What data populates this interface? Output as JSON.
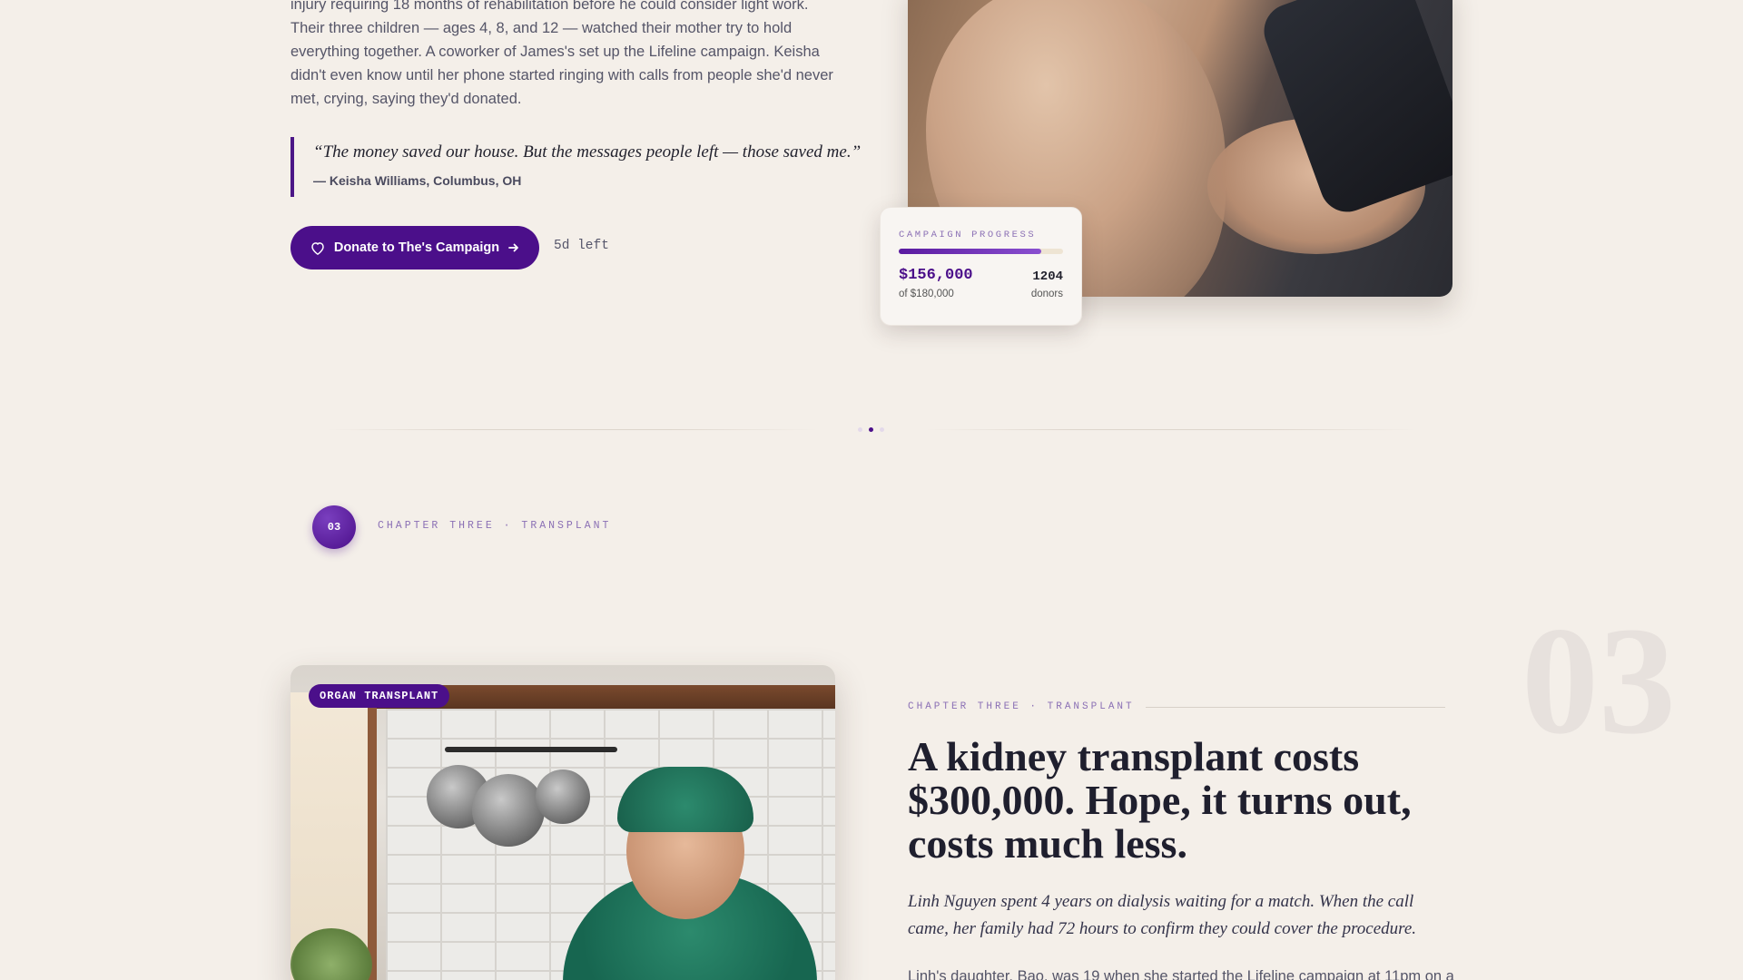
{
  "story": {
    "paragraph": "injury requiring 18 months of rehabilitation before he could consider light work. Their three children — ages 4, 8, and 12 — watched their mother try to hold everything together. A coworker of James's set up the Lifeline campaign. Keisha didn't even know until her phone started ringing with calls from people she'd never met, crying, saying they'd donated.",
    "quote": "“The money saved our house. But the messages people left — those saved me.”",
    "quote_attribution": "— Keisha Williams, Columbus, OH",
    "donate_label": "Donate to The's Campaign",
    "days_left": "5d left"
  },
  "progress_card": {
    "label": "CAMPAIGN PROGRESS",
    "raised": "$156,000",
    "goal": "of $180,000",
    "progress_fraction": 0.867,
    "donors_count": "1204",
    "donors_label": "donors"
  },
  "chapter": {
    "number": "03",
    "kicker": "CHAPTER THREE · TRANSPLANT",
    "ghost_number": "03",
    "photo_badge": "ORGAN TRANSPLANT",
    "heading": "A kidney transplant costs $300,000. Hope, it turns out, costs much less.",
    "lede": "Linh Nguyen spent 4 years on dialysis waiting for a match. When the call came, her family had 72 hours to confirm they could cover the procedure.",
    "body": "Linh's daughter, Bao, was 19 when she started the Lifeline campaign at 11pm on a"
  },
  "colors": {
    "accent": "#4b0f8a",
    "background": "#f4efe9",
    "kicker": "#8b70b5"
  },
  "icons": {
    "donate_left": "heart-icon",
    "donate_right": "arrow-right-icon"
  }
}
